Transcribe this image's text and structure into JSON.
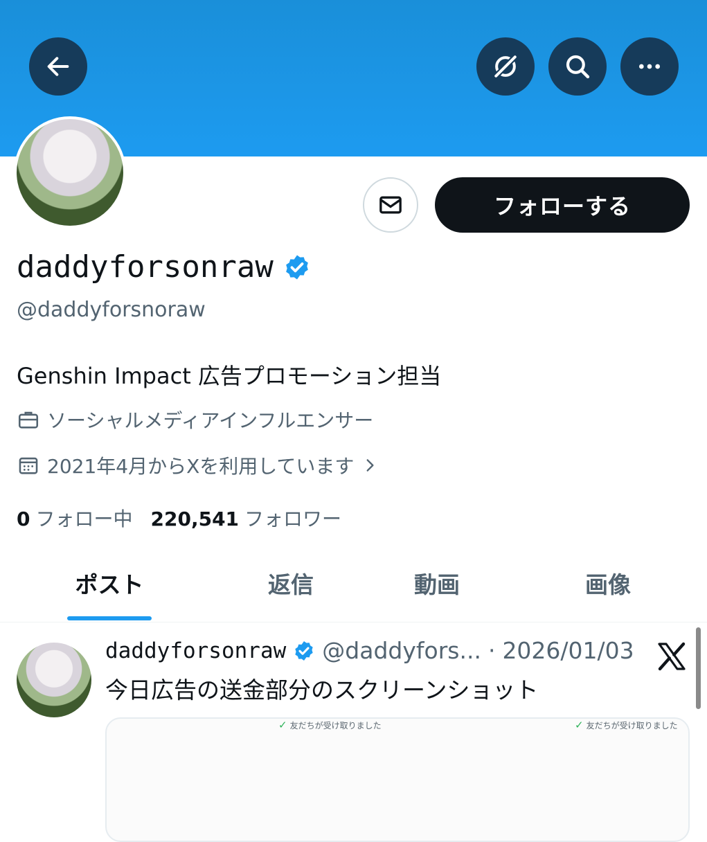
{
  "header": {
    "back_icon": "arrow-left-icon",
    "translate_icon": "grok-icon",
    "search_icon": "search-icon",
    "more_icon": "more-horizontal-icon",
    "banner_color": "#1d9bf0"
  },
  "profile": {
    "display_name": "daddyforsonraw",
    "verified_badge": "verified-icon",
    "handle": "@daddyforsnoraw",
    "bio": "Genshin Impact 広告プロモーション担当",
    "profession": "ソーシャルメディアインフルエンサー",
    "joined": "2021年4月からXを利用しています",
    "follow_button": "フォローする",
    "following_count": "0",
    "following_label": "フォロー中",
    "followers_count": "220,541",
    "followers_label": "フォロワー"
  },
  "tabs": [
    {
      "label": "ポスト",
      "active": true
    },
    {
      "label": "返信",
      "active": false
    },
    {
      "label": "動画",
      "active": false
    },
    {
      "label": "画像",
      "active": false
    }
  ],
  "post": {
    "name": "daddyforsonraw",
    "handle": "@daddyfors...",
    "separator": "·",
    "date": "2026/01/03",
    "text": "今日広告の送金部分のスクリーンショット",
    "media_labels": [
      "友だちが受け取りました",
      "友だちが受け取りました"
    ]
  },
  "colors": {
    "accent": "#1d9bf0",
    "follow_button_bg": "#0f1419",
    "header_button_bg": "#163b5a"
  }
}
